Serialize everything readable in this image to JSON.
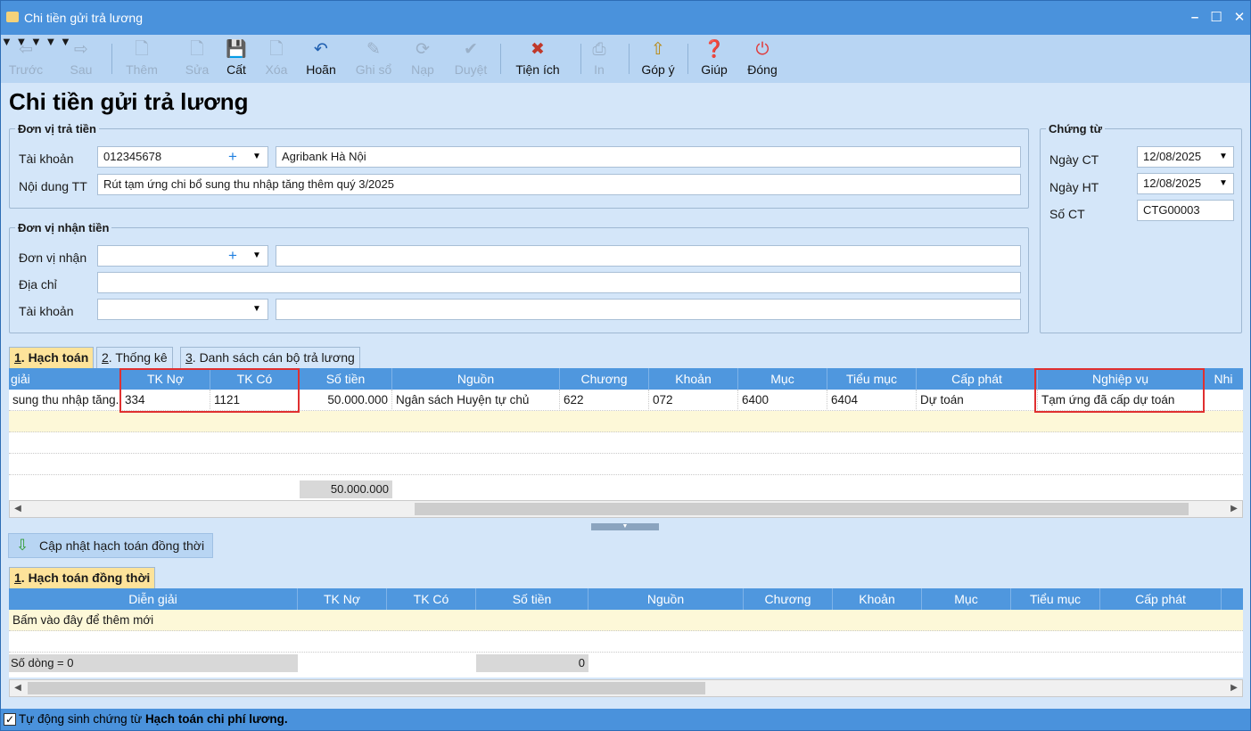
{
  "window": {
    "title": "Chi tiền gửi trả lương"
  },
  "toolbar": {
    "prev": "Trước",
    "next": "Sau",
    "add": "Thêm",
    "edit": "Sửa",
    "save": "Cất",
    "delete": "Xóa",
    "undo": "Hoãn",
    "post": "Ghi sổ",
    "reload": "Nạp",
    "approve": "Duyệt",
    "utilities": "Tiện ích",
    "print": "In",
    "feedback": "Góp ý",
    "help": "Giúp",
    "close": "Đóng"
  },
  "page": {
    "title": "Chi tiền gửi trả lương"
  },
  "payer": {
    "group_title": "Đơn vị trả tiền",
    "account_label": "Tài khoản",
    "account_value": "012345678",
    "bank_name": "Agribank Hà Nội",
    "content_label": "Nội dung TT",
    "content_value": "Rút tạm ứng chi bổ sung thu nhập tăng thêm quý 3/2025"
  },
  "voucher": {
    "group_title": "Chứng từ",
    "date_ct_label": "Ngày CT",
    "date_ct": "12/08/2025",
    "date_ht_label": "Ngày HT",
    "date_ht": "12/08/2025",
    "number_label": "Số CT",
    "number": "CTG00003"
  },
  "receiver": {
    "group_title": "Đơn vị nhận tiền",
    "unit_label": "Đơn vị nhận",
    "unit_value": "",
    "unit_name": "",
    "address_label": "Địa chỉ",
    "address_value": "",
    "account_label": "Tài khoản",
    "account_value": "",
    "account_bank": ""
  },
  "tabs": [
    {
      "key": "1",
      "label": ". Hạch toán"
    },
    {
      "key": "2",
      "label": ". Thống kê"
    },
    {
      "key": "3",
      "label": ". Danh sách cán bộ trả lương"
    }
  ],
  "grid1": {
    "headers": [
      "giải",
      "TK Nợ",
      "TK Có",
      "Số tiền",
      "Nguồn",
      "Chương",
      "Khoản",
      "Mục",
      "Tiểu mục",
      "Cấp phát",
      "Nghiệp vụ",
      "Nhi"
    ],
    "row": [
      "sung thu nhập tăng...",
      "334",
      "1121",
      "50.000.000",
      "Ngân sách Huyện tự chủ",
      "622",
      "072",
      "6400",
      "6404",
      "Dự toán",
      "Tạm ứng đã cấp dự toán",
      ""
    ],
    "total_amount": "50.000.000"
  },
  "update_button": "Cập nhật hạch toán đồng thời",
  "tab2": {
    "key": "1",
    "label": ". Hạch toán đồng thời"
  },
  "grid2": {
    "headers": [
      "Diễn giải",
      "TK Nợ",
      "TK Có",
      "Số tiền",
      "Nguồn",
      "Chương",
      "Khoản",
      "Mục",
      "Tiểu mục",
      "Cấp phát"
    ],
    "placeholder_row": "Bấm vào đây để thêm mới",
    "row_count": "Số dòng = 0",
    "total_amount": "0"
  },
  "status": {
    "prefix": "Tự động sinh chứng từ ",
    "bold": "Hạch toán chi phí lương."
  }
}
